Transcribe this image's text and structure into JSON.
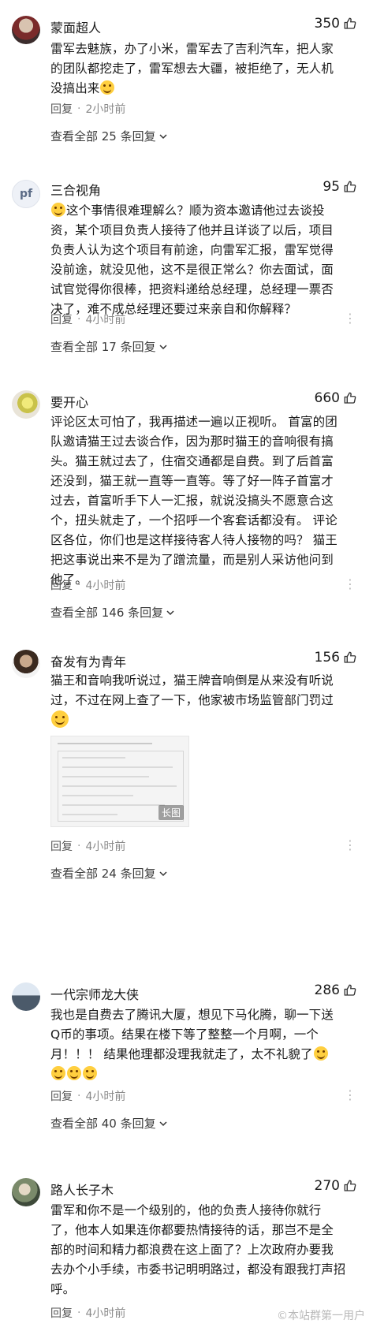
{
  "comments": [
    {
      "username": "蒙面超人",
      "likes": "350",
      "lines": [
        "雷军去魅族，办了小米，雷军去了吉利汽车，把人家",
        "的团队都挖走了，雷军想去大疆，被拒绝了，无人机",
        "没搞出来"
      ],
      "reply": "回复",
      "time": "2小时前",
      "view_all": "查看全部 25 条回复"
    },
    {
      "username": "三合视角",
      "avatar_text": "pf",
      "likes": "95",
      "lines": [
        "这个事情很难理解么？顺为资本邀请他过去谈投",
        "资，某个项目负责人接待了他并且详谈了以后，项目",
        "负责人认为这个项目有前途，向雷军汇报，雷军觉得",
        "没前途，就没见他，这不是很正常么？你去面试，面",
        "试官觉得你很棒，把资料递给总经理，总经理一票否",
        "决了，难不成总经理还要过来亲自和你解释？"
      ],
      "reply": "回复",
      "time": "4小时前",
      "view_all": "查看全部 17 条回复"
    },
    {
      "username": "要开心",
      "likes": "660",
      "lines": [
        "评论区太可怕了，我再描述一遍以正视听。 首富的团",
        "队邀请猫王过去谈合作，因为那时猫王的音响很有搞",
        "头。猫王就过去了，住宿交通都是自费。到了后首富",
        "还没到，猫王就一直等一直等。等了好一阵子首富才",
        "过去，首富听手下人一汇报，就说没搞头不愿意合这",
        "个，扭头就走了，一个招呼一个客套话都没有。 评论",
        "区各位，你们也是这样接待客人待人接物的吗？ 猫王",
        "把这事说出来不是为了蹭流量，而是别人采访他问到",
        "他了。"
      ],
      "reply": "回复",
      "time": "4小时前",
      "view_all": "查看全部 146 条回复"
    },
    {
      "username": "奋发有为青年",
      "likes": "156",
      "lines": [
        "猫王和音响我听说过，猫王牌音响倒是从来没有听说",
        "过，不过在网上查了一下，他家被市场监管部门罚过"
      ],
      "image_tag": "长图",
      "reply": "回复",
      "time": "4小时前",
      "view_all": "查看全部 24 条回复"
    },
    {
      "username": "一代宗师龙大侠",
      "likes": "286",
      "lines": [
        "我也是自费去了腾讯大厦，想见下马化腾，聊一下送",
        "Q币的事项。结果在楼下等了整整一个月啊，一个",
        "月！！！ 结果他理都没理我就走了，太不礼貌了"
      ],
      "reply": "回复",
      "time": "4小时前",
      "view_all": "查看全部 40 条回复"
    },
    {
      "username": "路人长子木",
      "likes": "270",
      "lines": [
        "雷军和你不是一个级别的，他的负责人接待你就行",
        "了，他本人如果连你都要热情接待的话，那岂不是全",
        "部的时间和精力都浪费在这上面了？上次政府办要我",
        "去办个小手续，市委书记明明路过，都没有跟我打声招",
        "呼。"
      ],
      "reply": "回复",
      "time": "4小时前"
    }
  ],
  "watermark": "©本站群第一用户",
  "icons": {
    "like": "thumbs-up-icon",
    "more": "more-dots-icon",
    "chevron": "chevron-down-icon",
    "emoji": "grin-emoji-icon"
  },
  "colors": {
    "meta": "#8a8a8a",
    "emoji": "#ffcf3f"
  }
}
